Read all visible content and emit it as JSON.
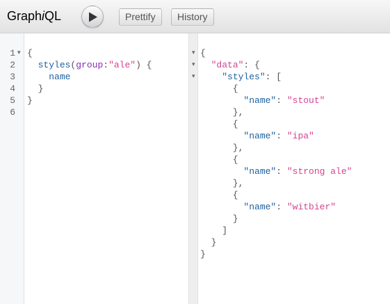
{
  "toolbar": {
    "title_prefix": "Graph",
    "title_italic": "i",
    "title_suffix": "QL",
    "execute_icon": "play-icon",
    "prettify_label": "Prettify",
    "history_label": "History"
  },
  "query_editor": {
    "line_numbers": [
      "1",
      "2",
      "3",
      "4",
      "5",
      "6"
    ],
    "fold_marker": "▾",
    "lines": [
      [
        {
          "t": "{",
          "c": "punct"
        }
      ],
      [
        {
          "t": "  ",
          "c": "punct"
        },
        {
          "t": "styles",
          "c": "field"
        },
        {
          "t": "(",
          "c": "punct"
        },
        {
          "t": "group",
          "c": "arg"
        },
        {
          "t": ":",
          "c": "punct"
        },
        {
          "t": "\"ale\"",
          "c": "str"
        },
        {
          "t": ") {",
          "c": "punct"
        }
      ],
      [
        {
          "t": "    ",
          "c": "punct"
        },
        {
          "t": "name",
          "c": "field"
        }
      ],
      [
        {
          "t": "  }",
          "c": "punct"
        }
      ],
      [
        {
          "t": "}",
          "c": "punct"
        }
      ],
      []
    ]
  },
  "result_viewer": {
    "fold_marker": "▾",
    "lines": [
      [
        {
          "t": "{",
          "c": "punct"
        }
      ],
      [
        {
          "t": "  ",
          "c": "punct"
        },
        {
          "t": "\"data\"",
          "c": "str"
        },
        {
          "t": ": {",
          "c": "punct"
        }
      ],
      [
        {
          "t": "    ",
          "c": "punct"
        },
        {
          "t": "\"styles\"",
          "c": "field"
        },
        {
          "t": ": [",
          "c": "punct"
        }
      ],
      [
        {
          "t": "      {",
          "c": "punct"
        }
      ],
      [
        {
          "t": "        ",
          "c": "punct"
        },
        {
          "t": "\"name\"",
          "c": "field"
        },
        {
          "t": ": ",
          "c": "punct"
        },
        {
          "t": "\"stout\"",
          "c": "str"
        }
      ],
      [
        {
          "t": "      },",
          "c": "punct"
        }
      ],
      [
        {
          "t": "      {",
          "c": "punct"
        }
      ],
      [
        {
          "t": "        ",
          "c": "punct"
        },
        {
          "t": "\"name\"",
          "c": "field"
        },
        {
          "t": ": ",
          "c": "punct"
        },
        {
          "t": "\"ipa\"",
          "c": "str"
        }
      ],
      [
        {
          "t": "      },",
          "c": "punct"
        }
      ],
      [
        {
          "t": "      {",
          "c": "punct"
        }
      ],
      [
        {
          "t": "        ",
          "c": "punct"
        },
        {
          "t": "\"name\"",
          "c": "field"
        },
        {
          "t": ": ",
          "c": "punct"
        },
        {
          "t": "\"strong ale\"",
          "c": "str"
        }
      ],
      [
        {
          "t": "      },",
          "c": "punct"
        }
      ],
      [
        {
          "t": "      {",
          "c": "punct"
        }
      ],
      [
        {
          "t": "        ",
          "c": "punct"
        },
        {
          "t": "\"name\"",
          "c": "field"
        },
        {
          "t": ": ",
          "c": "punct"
        },
        {
          "t": "\"witbier\"",
          "c": "str"
        }
      ],
      [
        {
          "t": "      }",
          "c": "punct"
        }
      ],
      [
        {
          "t": "    ]",
          "c": "punct"
        }
      ],
      [
        {
          "t": "  }",
          "c": "punct"
        }
      ],
      [
        {
          "t": "}",
          "c": "punct"
        }
      ]
    ]
  }
}
